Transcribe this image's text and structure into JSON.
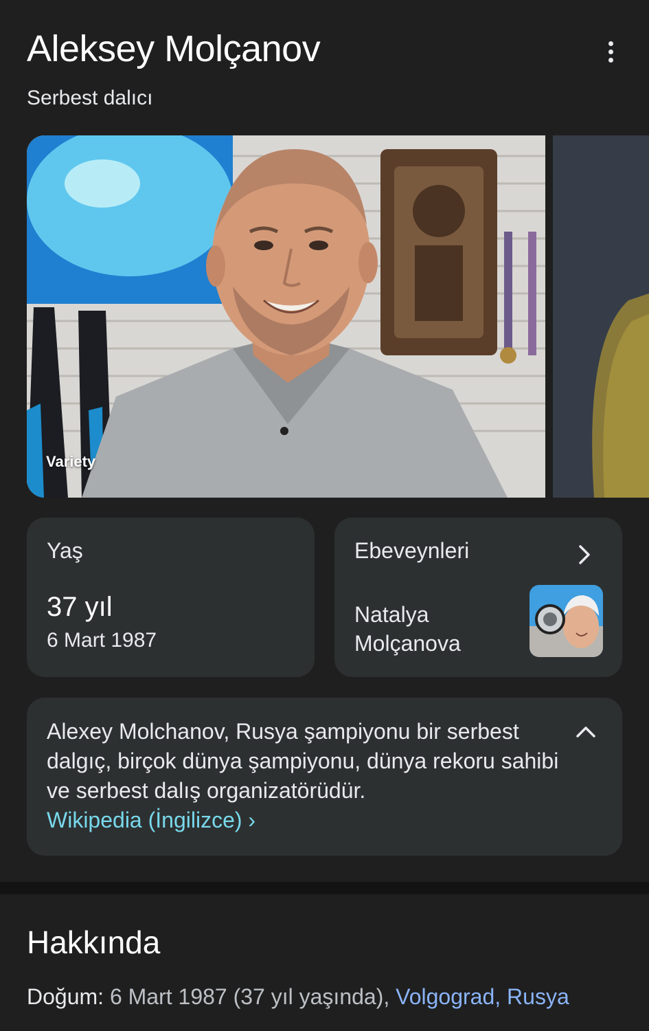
{
  "header": {
    "title": "Aleksey Molçanov",
    "subtitle": "Serbest dalıcı"
  },
  "gallery": {
    "main_photo_source": "Variety"
  },
  "age_card": {
    "label": "Yaş",
    "value": "37 yıl",
    "date": "6 Mart 1987"
  },
  "parents_card": {
    "label": "Ebeveynleri",
    "name_line1": "Natalya",
    "name_line2": "Molçanova"
  },
  "description": {
    "text": "Alexey Molchanov, Rusya şampiyonu bir serbest dalgıç, birçok dünya şampiyonu, dünya rekoru sahibi ve serbest dalış organizatörüdür.",
    "link_label": "Wikipedia (İngilizce) ›"
  },
  "about": {
    "title": "Hakkında",
    "birth_label": "Doğum:",
    "birth_value": "6 Mart 1987 (37 yıl yaşında),",
    "birth_place": "Volgograd, Rusya"
  },
  "colors": {
    "background": "#1f1f1f",
    "card": "#2d3031",
    "link_teal": "#78d9ec",
    "link_blue": "#8ab4f8"
  }
}
